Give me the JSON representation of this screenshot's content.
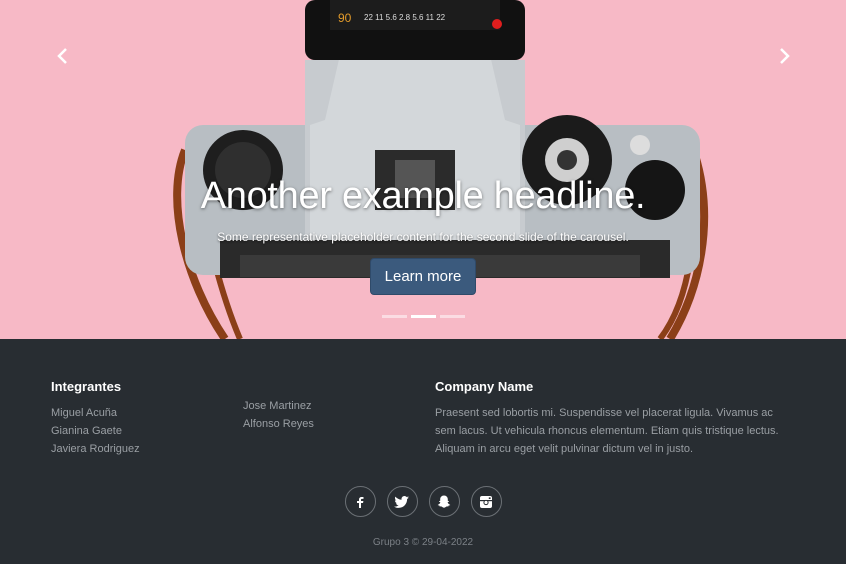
{
  "colors": {
    "carousel_bg": "#f7b9c6",
    "footer_bg": "#282d32",
    "button_bg": "#3b5a7d",
    "muted_text": "#9a9fa4"
  },
  "carousel": {
    "headline": "Another example headline.",
    "subtext": "Some representative placeholder content for the second slide of the carousel.",
    "button_label": "Learn more",
    "active_slide": 2,
    "slide_count": 3,
    "lens_marks": "90  22 11 5.6 2.8 5.6 11 22"
  },
  "footer": {
    "members_title": "Integrantes",
    "members_col1": [
      "Miguel Acuña",
      "Gianina Gaete",
      "Javiera Rodriguez"
    ],
    "members_col2": [
      "Jose Martinez",
      "Alfonso Reyes"
    ],
    "company_title": "Company Name",
    "company_text": "Praesent sed lobortis mi. Suspendisse vel placerat ligula. Vivamus ac sem lacus. Ut vehicula rhoncus elementum. Etiam quis tristique lectus. Aliquam in arcu eget velit pulvinar dictum vel in justo.",
    "social_icons": [
      "facebook-icon",
      "twitter-icon",
      "snapchat-icon",
      "instagram-icon"
    ],
    "copyright": "Grupo 3 © 29-04-2022"
  }
}
